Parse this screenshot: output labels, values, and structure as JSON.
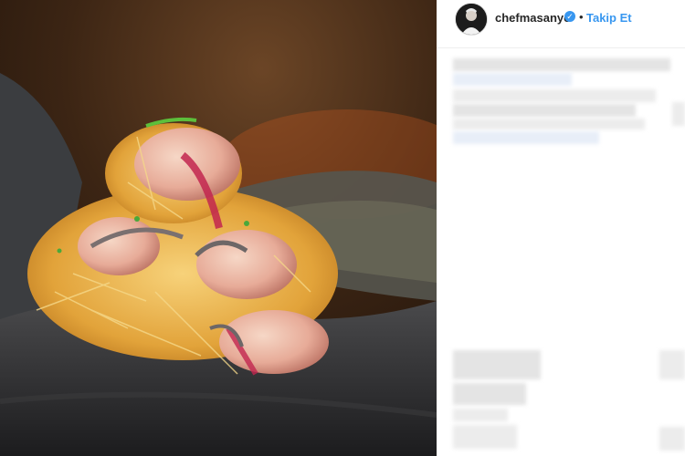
{
  "post": {
    "username": "chefmasanyc",
    "verified_icon": "verified-badge-icon",
    "separator": "•",
    "follow_label": "Takip Et"
  },
  "colors": {
    "link_blue": "#3897f0",
    "text_dark": "#262626",
    "divider": "#efefef"
  }
}
